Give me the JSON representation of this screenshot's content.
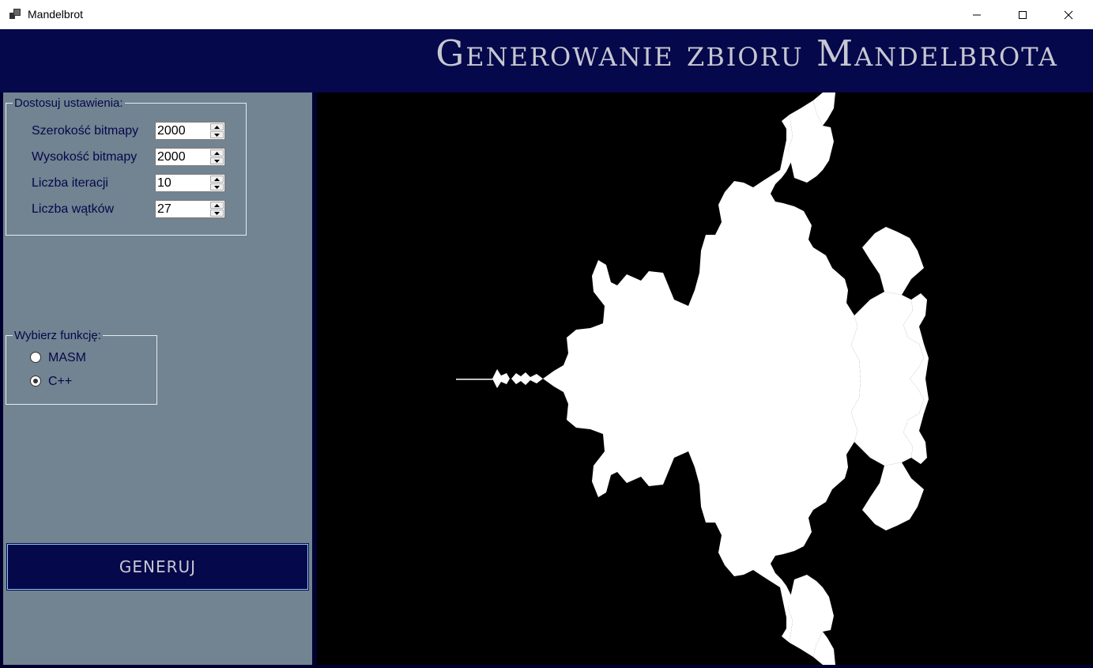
{
  "window": {
    "title": "Mandelbrot",
    "controls": [
      "minimize",
      "maximize",
      "close"
    ]
  },
  "header": {
    "title": "Generowanie zbioru Mandelbrota"
  },
  "settings": {
    "group_label": "Dostosuj ustawienia:",
    "width_label": "Szerokość bitmapy",
    "width_value": "2000",
    "height_label": "Wysokość bitmapy",
    "height_value": "2000",
    "iterations_label": "Liczba iteracji",
    "iterations_value": "10",
    "threads_label": "Liczba wątków",
    "threads_value": "27"
  },
  "function": {
    "group_label": "Wybierz funkcję:",
    "options": [
      {
        "label": "MASM",
        "selected": false
      },
      {
        "label": "C++",
        "selected": true
      }
    ]
  },
  "actions": {
    "generate_label": "GENERUJ"
  },
  "colors": {
    "header_bg": "#05084a",
    "panel_bg": "#728391",
    "label_text": "#05084a",
    "title_text": "#c7c7d2",
    "fractal_fill": "#ffffff",
    "canvas_bg": "#000000"
  }
}
